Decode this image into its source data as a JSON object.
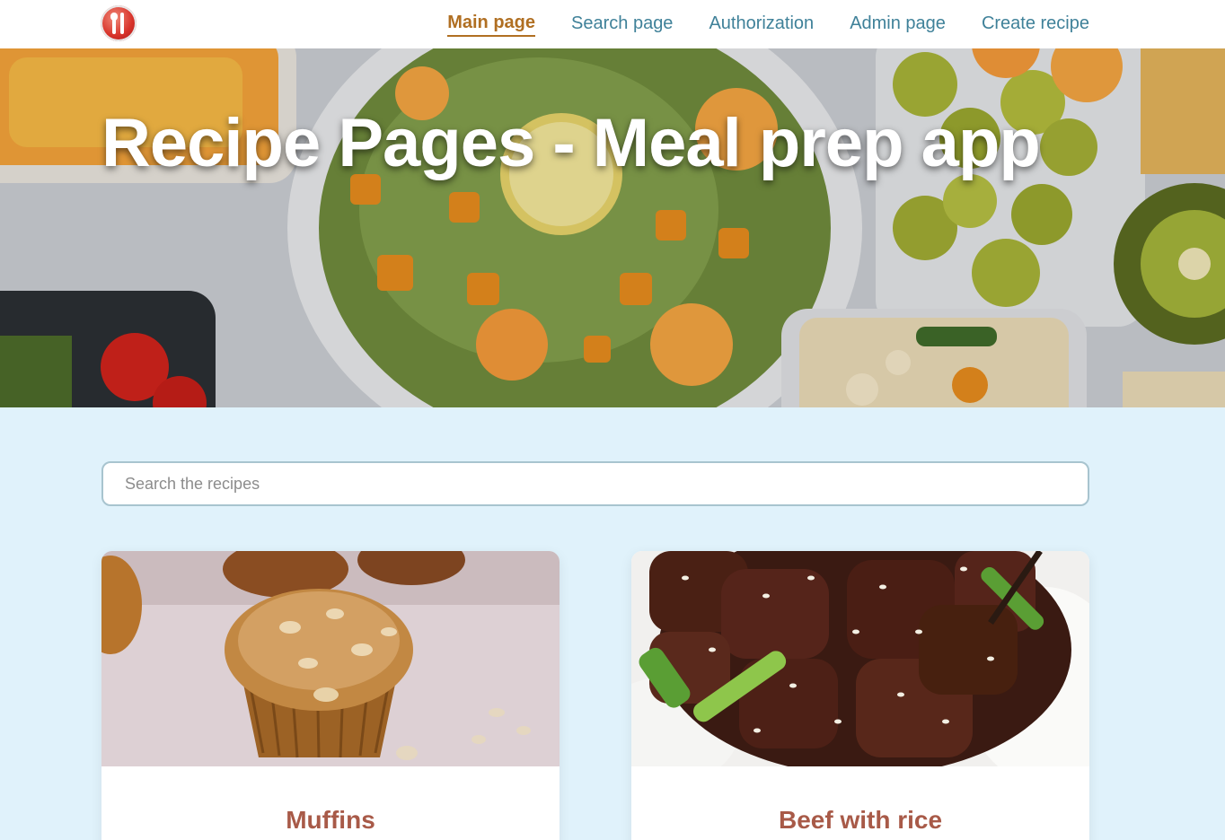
{
  "header": {
    "logo_icon": "utensils-logo-icon",
    "nav": [
      {
        "label": "Main page",
        "active": true
      },
      {
        "label": "Search page",
        "active": false
      },
      {
        "label": "Authorization",
        "active": false
      },
      {
        "label": "Admin page",
        "active": false
      },
      {
        "label": "Create recipe",
        "active": false
      }
    ]
  },
  "hero": {
    "title": "Recipe Pages - Meal prep app"
  },
  "search": {
    "placeholder": "Search the recipes",
    "value": ""
  },
  "recipes": [
    {
      "title": "Muffins"
    },
    {
      "title": "Beef with rice"
    }
  ],
  "colors": {
    "nav_link": "#3f8199",
    "nav_active": "#b06f22",
    "page_background": "#e0f2fb",
    "card_title": "#a85a48"
  }
}
